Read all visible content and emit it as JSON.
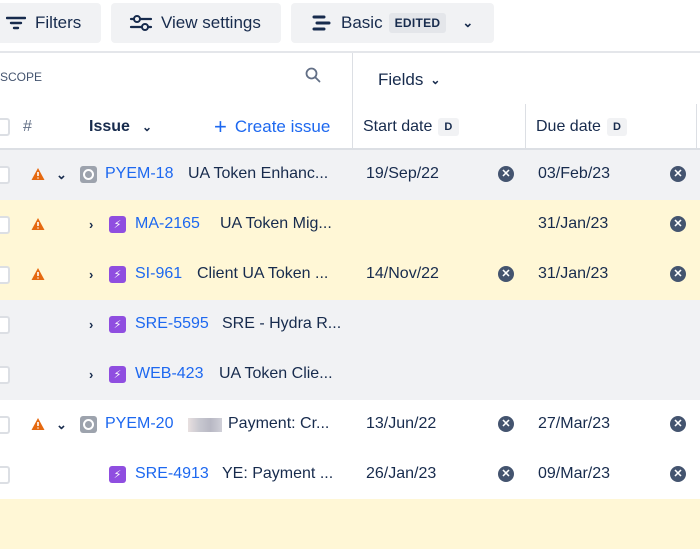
{
  "toolbar": {
    "filters": "Filters",
    "view_settings": "View settings",
    "view": "Basic",
    "view_badge": "EDITED"
  },
  "scope": {
    "label": "SCOPE"
  },
  "columns": {
    "hash": "#",
    "issue": "Issue",
    "create_issue": "Create issue",
    "fields": "Fields",
    "start_date": "Start date",
    "start_badge": "D",
    "due_date": "Due date",
    "due_badge": "D"
  },
  "colors": {
    "link": "#1d68f0",
    "warning": "#e56910",
    "task": "#8f4ee0",
    "highlight": "#fff7d6",
    "grey_row": "#f1f2f4"
  },
  "rows": [
    {
      "key": "PYEM-18",
      "summary": "UA Token Enhanc...",
      "start": "19/Sep/22",
      "due": "03/Feb/23"
    },
    {
      "key": "MA-2165",
      "summary": "UA Token Mig...",
      "start": "",
      "due": "31/Jan/23"
    },
    {
      "key": "SI-961",
      "summary": "Client UA Token ...",
      "start": "14/Nov/22",
      "due": "31/Jan/23"
    },
    {
      "key": "SRE-5595",
      "summary": "SRE - Hydra R...",
      "start": "",
      "due": ""
    },
    {
      "key": "WEB-423",
      "summary": "UA Token Clie...",
      "start": "",
      "due": ""
    },
    {
      "key": "PYEM-20",
      "summary": "Payment: Cr...",
      "start": "13/Jun/22",
      "due": "27/Mar/23"
    },
    {
      "key": "SRE-4913",
      "summary": "YE: Payment ...",
      "start": "26/Jan/23",
      "due": "09/Mar/23"
    }
  ]
}
